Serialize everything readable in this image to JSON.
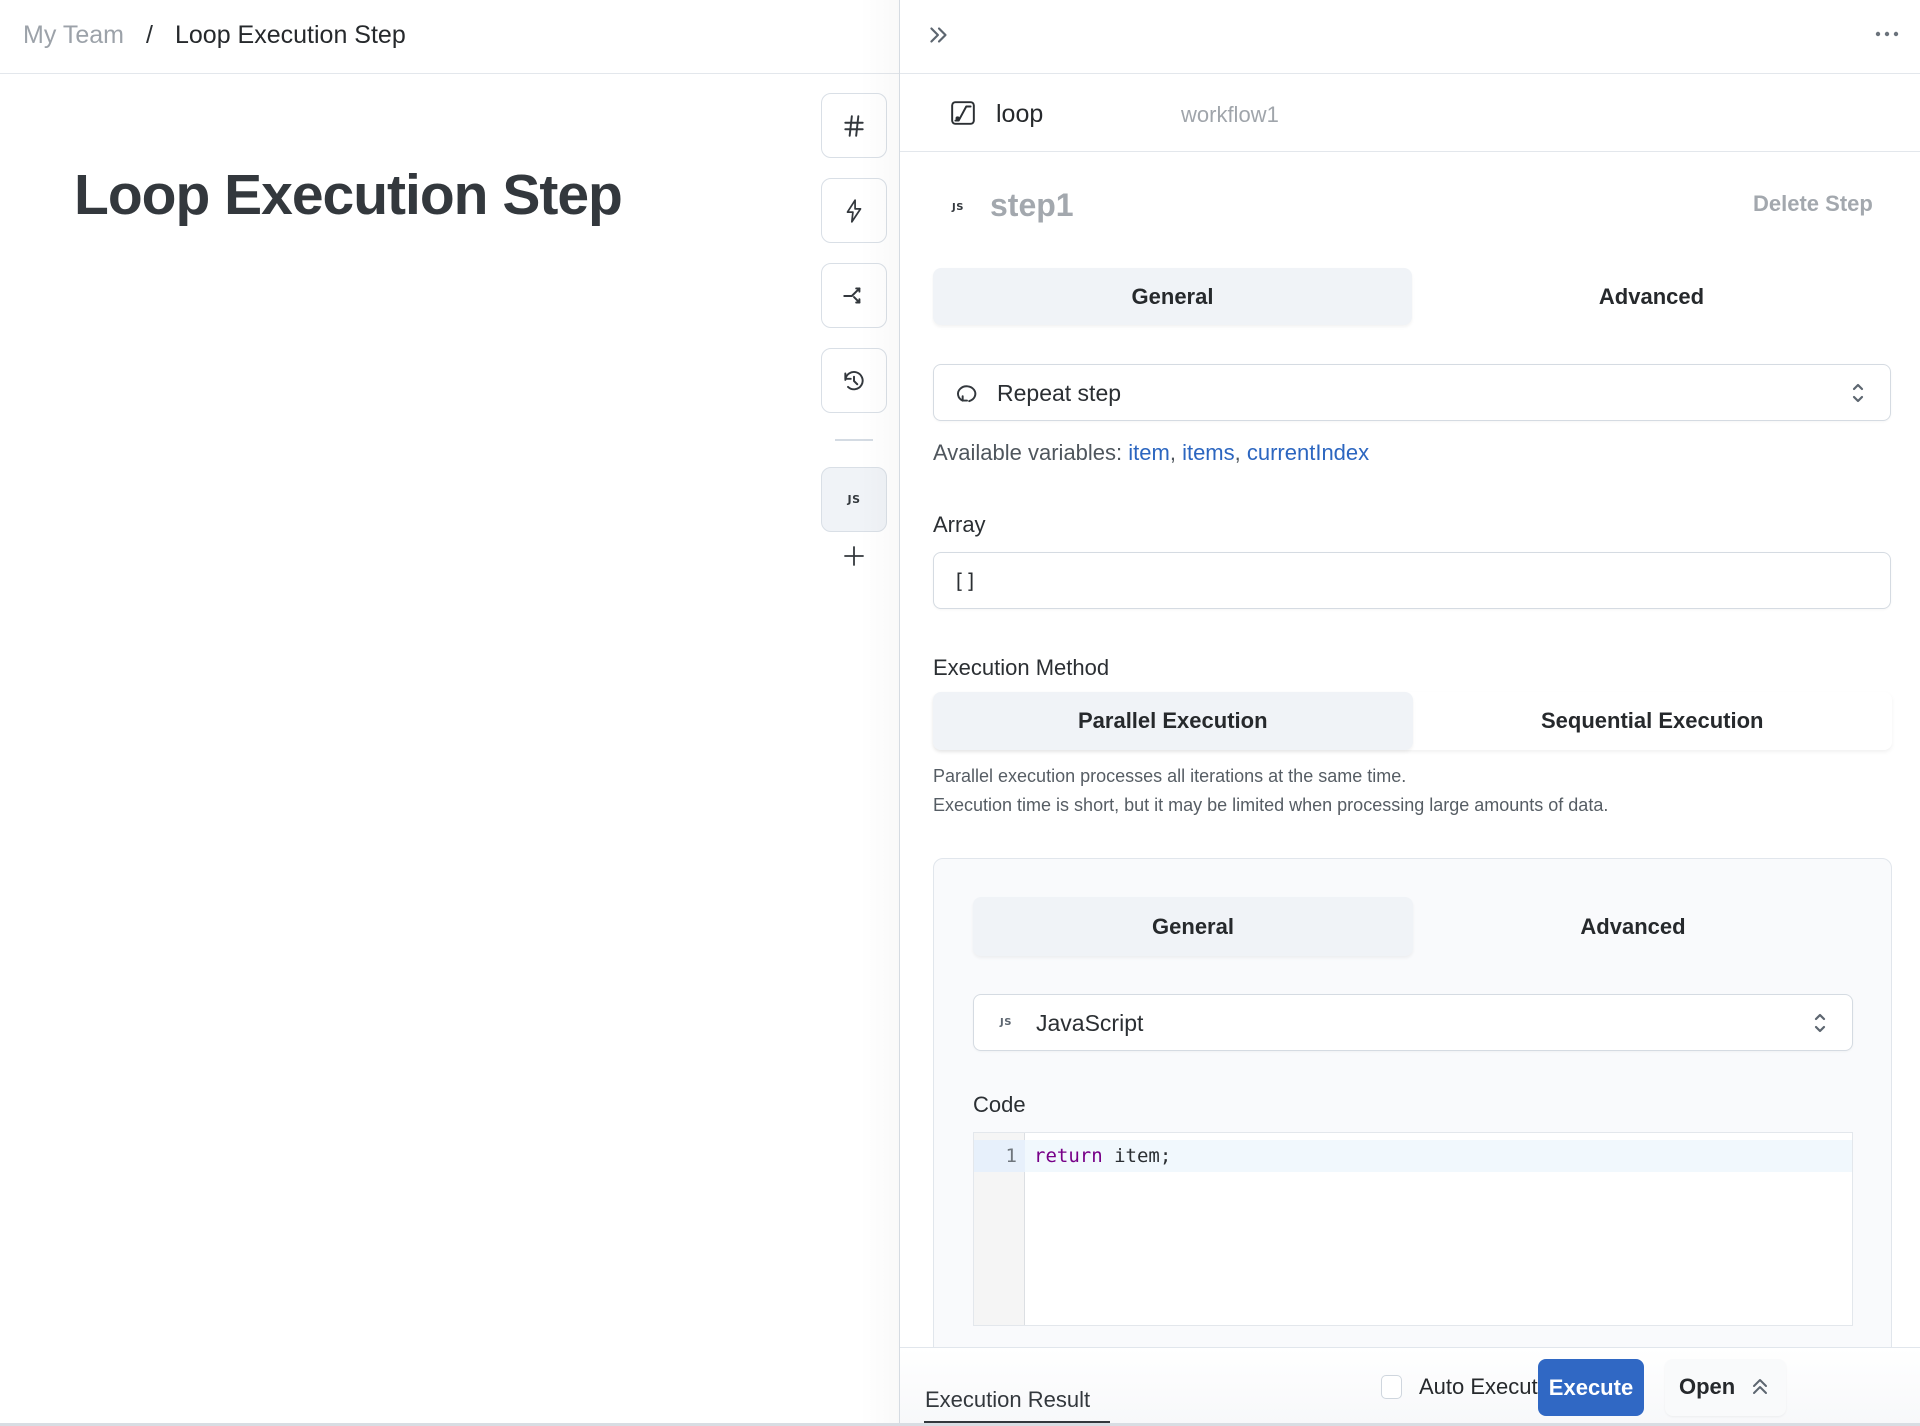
{
  "breadcrumb": {
    "team": "My Team",
    "separator": "/",
    "current": "Loop Execution Step"
  },
  "page": {
    "title": "Loop Execution Step"
  },
  "rail": {
    "buttons": [
      {
        "icon": "hash-icon"
      },
      {
        "icon": "lightning-icon"
      },
      {
        "icon": "branch-icon"
      },
      {
        "icon": "history-icon"
      }
    ],
    "js_button_label": "JS",
    "add_icon": "plus-icon"
  },
  "panel": {
    "header": {
      "collapse_icon": "double-chevron-right-icon",
      "more_icon": "more-horizontal-icon"
    },
    "loop": {
      "name": "loop",
      "workflow": "workflow1"
    },
    "step": {
      "badge": "JS",
      "name": "step1",
      "delete_label": "Delete Step"
    },
    "tabs": [
      {
        "label": "General",
        "active": true
      },
      {
        "label": "Advanced",
        "active": false
      }
    ],
    "mode_select": {
      "value": "Repeat step"
    },
    "variables": {
      "prefix": "Available variables: ",
      "items": [
        "item",
        "items",
        "currentIndex"
      ],
      "separator": ", "
    },
    "array": {
      "label": "Array",
      "value": "[]"
    },
    "execution_method": {
      "label": "Execution Method",
      "options": [
        {
          "label": "Parallel Execution",
          "active": true
        },
        {
          "label": "Sequential Execution",
          "active": false
        }
      ],
      "description": [
        "Parallel execution processes all iterations at the same time.",
        "Execution time is short, but it may be limited when processing large amounts of data."
      ]
    },
    "inner": {
      "tabs": [
        {
          "label": "General",
          "active": true
        },
        {
          "label": "Advanced",
          "active": false
        }
      ],
      "language_select": {
        "badge": "JS",
        "value": "JavaScript"
      },
      "code": {
        "label": "Code",
        "lines": [
          {
            "number": "1",
            "keyword": "return",
            "rest": " item;"
          }
        ]
      }
    },
    "footer": {
      "result_tab": "Execution Result",
      "auto_execution_label": "Auto Execution",
      "auto_execution_checked": false,
      "execute_label": "Execute",
      "open_label": "Open"
    }
  },
  "colors": {
    "accent": "#3068c4",
    "link": "#2c66c0",
    "keyword": "#770088"
  }
}
